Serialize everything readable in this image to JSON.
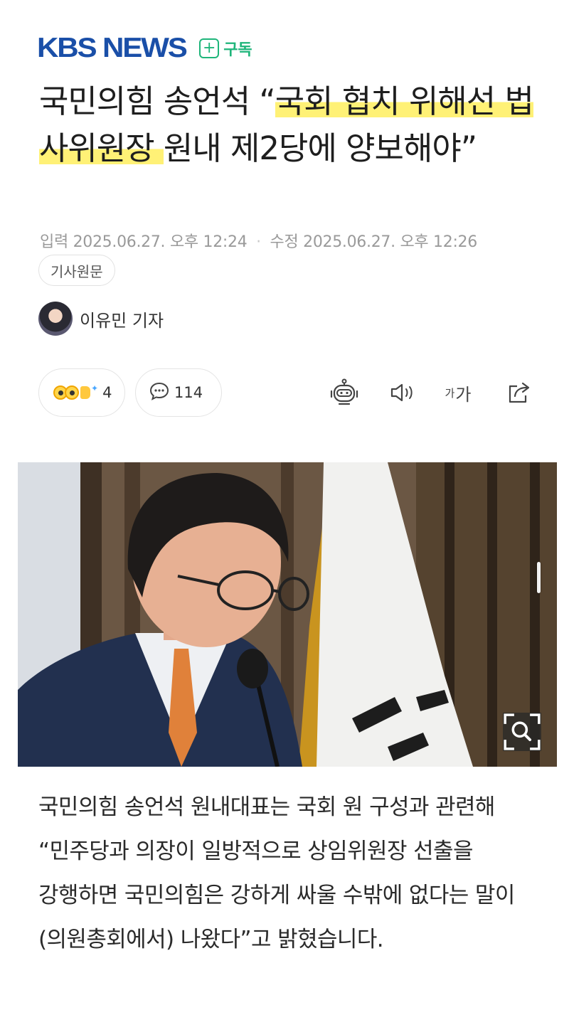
{
  "header": {
    "logo_text": "KBS NEWS",
    "subscribe_label": "구독"
  },
  "headline": {
    "part1": "국민의힘 송언석 “",
    "highlight": "국회 협치 위해선 법사위원장 ",
    "part2": "원내 제2당에 양보해야”"
  },
  "meta": {
    "input_label": "입력",
    "input_datetime": "2025.06.27. 오후 12:24",
    "edit_label": "수정",
    "edit_datetime": "2025.06.27. 오후 12:26",
    "original_button": "기사원문"
  },
  "reporter": {
    "name": "이유민 기자"
  },
  "actions": {
    "reaction_count": "4",
    "comment_count": "114",
    "font_small": "가",
    "font_large": "가"
  },
  "photo": {
    "icon": "zoom-icon"
  },
  "article": {
    "paragraph": "국민의힘 송언석 원내대표는 국회 원 구성과 관련해 “민주당과 의장이 일방적으로 상임위원장 선출을 강행하면 국민의힘은 강하게 싸울 수밖에 없다는 말이 (의원총회에서) 나왔다”고 밝혔습니다."
  },
  "colors": {
    "brand_blue": "#1a4fa8",
    "subscribe_green": "#1fb57a",
    "highlight_yellow": "#fff176",
    "meta_gray": "#9a9a9a"
  }
}
